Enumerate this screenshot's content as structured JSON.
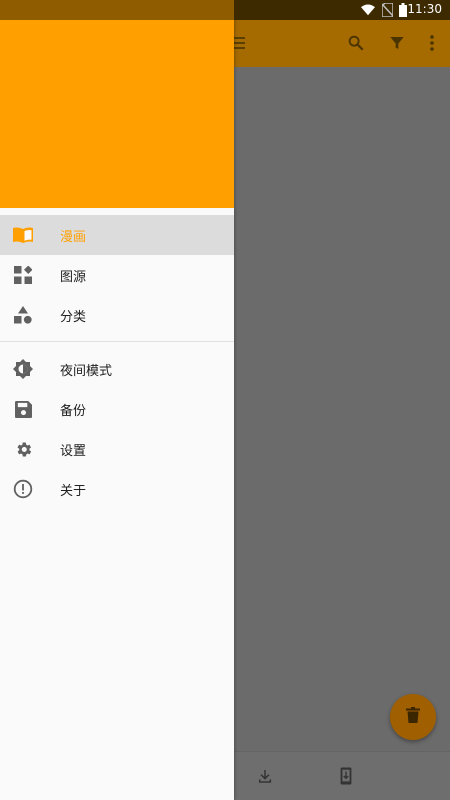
{
  "status_bar": {
    "time": "11:30",
    "icons": [
      "wifi-icon",
      "no-sim-icon",
      "battery-icon"
    ]
  },
  "colors": {
    "accent": "#ffa000",
    "drawer_bg": "#fafafa",
    "active_item_bg": "#dcdcdc",
    "icon_gray": "#616161",
    "scrim_app_bar": "#a56a00"
  },
  "app_bar": {
    "actions": [
      "search-icon",
      "filter-icon",
      "more-vert-icon"
    ]
  },
  "drawer": {
    "primary_items": [
      {
        "label": "漫画",
        "icon": "book-icon",
        "active": true
      },
      {
        "label": "图源",
        "icon": "dashboard-icon",
        "active": false
      },
      {
        "label": "分类",
        "icon": "category-icon",
        "active": false
      }
    ],
    "secondary_items": [
      {
        "label": "夜间模式",
        "icon": "brightness-icon"
      },
      {
        "label": "备份",
        "icon": "save-icon"
      },
      {
        "label": "设置",
        "icon": "settings-icon"
      },
      {
        "label": "关于",
        "icon": "info-icon"
      }
    ]
  },
  "fab": {
    "icon": "delete-icon"
  },
  "bottom_bar": {
    "items": [
      "download-icon",
      "phone-download-icon"
    ]
  }
}
